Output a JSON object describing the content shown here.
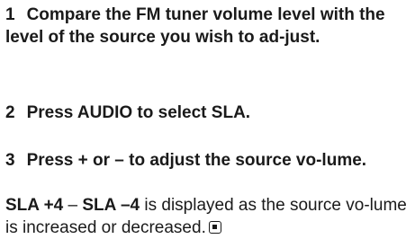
{
  "steps": [
    {
      "number": "1",
      "text": "Compare the FM tuner volume level with the level of the source you wish to ad-just."
    },
    {
      "number": "2",
      "text": "Press AUDIO to select SLA."
    },
    {
      "number": "3",
      "text": "Press + or – to adjust the source vo-lume."
    }
  ],
  "note": {
    "bold_start": "SLA +4",
    "separator": " – ",
    "bold_end": "SLA –4",
    "rest": " is displayed as the source vo-lume is increased or decreased.",
    "end_icon": "end-of-section-icon"
  }
}
